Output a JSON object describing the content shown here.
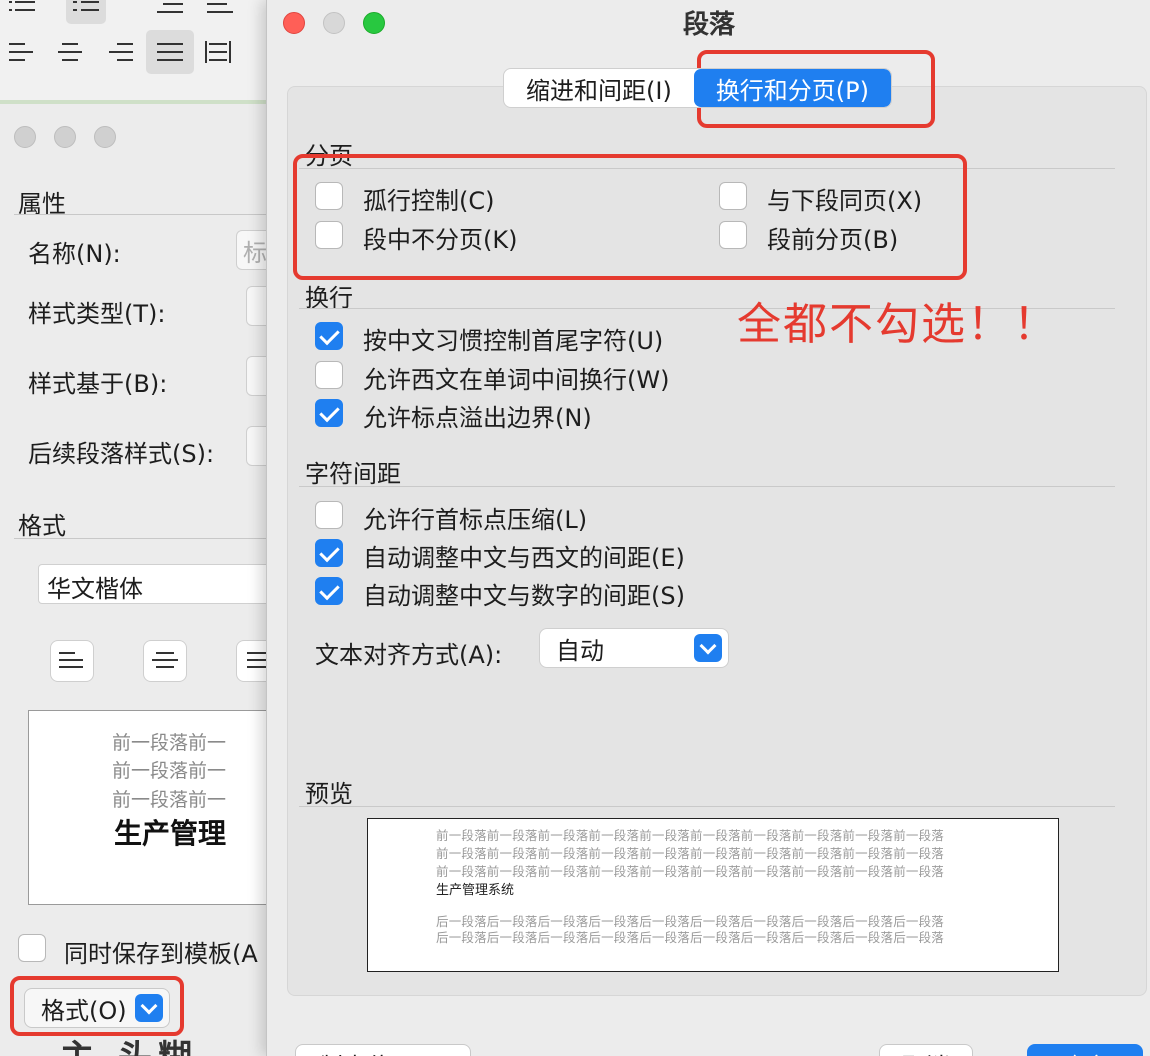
{
  "toolbar": {
    "icons": [
      "numbered-list-icon",
      "bulleted-list-icon",
      "decrease-indent-icon",
      "increase-indent-icon",
      "align-left-icon",
      "align-center-icon",
      "align-right-icon",
      "justify-icon",
      "distributed-icon"
    ]
  },
  "style_dialog": {
    "section_properties": "属性",
    "name_label": "名称(N):",
    "name_value_partial": "标",
    "style_type_label": "样式类型(T):",
    "based_on_label": "样式基于(B):",
    "following_style_label": "后续段落样式(S):",
    "section_format": "格式",
    "font_value": "华文楷体",
    "preview_prev_line": "前一段落前一",
    "preview_main": "生产管理",
    "save_template_label": "同时保存到模板(A",
    "format_button_label": "格式(O)",
    "bottom_text": "主 头糊"
  },
  "paragraph_dialog": {
    "title": "段落",
    "tabs": [
      {
        "label": "缩进和间距(I)",
        "active": false
      },
      {
        "label": "换行和分页(P)",
        "active": true
      }
    ],
    "sections": {
      "pagination": {
        "title": "分页",
        "options": [
          {
            "label": "孤行控制(C)",
            "checked": false
          },
          {
            "label": "与下段同页(X)",
            "checked": false
          },
          {
            "label": "段中不分页(K)",
            "checked": false
          },
          {
            "label": "段前分页(B)",
            "checked": false
          }
        ]
      },
      "line_break": {
        "title": "换行",
        "options": [
          {
            "label": "按中文习惯控制首尾字符(U)",
            "checked": true
          },
          {
            "label": "允许西文在单词中间换行(W)",
            "checked": false
          },
          {
            "label": "允许标点溢出边界(N)",
            "checked": true
          }
        ]
      },
      "char_spacing": {
        "title": "字符间距",
        "options": [
          {
            "label": "允许行首标点压缩(L)",
            "checked": false
          },
          {
            "label": "自动调整中文与西文的间距(E)",
            "checked": true
          },
          {
            "label": "自动调整中文与数字的间距(S)",
            "checked": true
          }
        ],
        "text_alignment_label": "文本对齐方式(A):",
        "text_alignment_value": "自动"
      },
      "preview": {
        "title": "预览",
        "prev_line": "前一段落前一段落前一段落前一段落前一段落前一段落前一段落前一段落前一段落前一段落",
        "main_text": "生产管理系统",
        "next_line": "后一段落后一段落后一段落后一段落后一段落后一段落后一段落后一段落后一段落后一段落"
      }
    },
    "annotation": "全都不勾选！！",
    "buttons": {
      "tabs_button": "制表位(T)...",
      "cancel": "取消",
      "ok": "确定"
    }
  },
  "colors": {
    "accent": "#1f7ff0",
    "annotation_red": "#e53a2f"
  }
}
